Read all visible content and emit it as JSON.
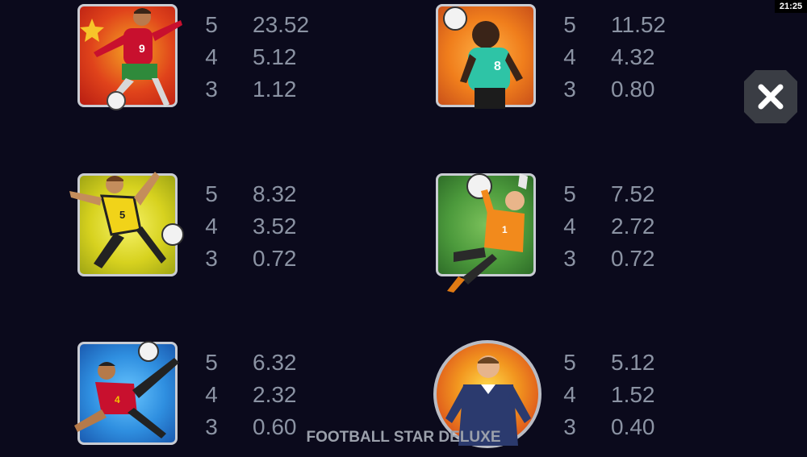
{
  "status_bar": {
    "time": "21:25"
  },
  "footer": {
    "game_title": "FOOTBALL STAR DELUXE"
  },
  "close_icon": "close-icon",
  "colors": {
    "background": "#0b0a1c",
    "text": "#8b93a3",
    "frame": "#c9ccd3"
  },
  "symbols": [
    {
      "name": "red-player-symbol",
      "payouts": [
        {
          "count": "5",
          "value": "23.52"
        },
        {
          "count": "4",
          "value": "5.12"
        },
        {
          "count": "3",
          "value": "1.12"
        }
      ]
    },
    {
      "name": "teal-player-symbol",
      "payouts": [
        {
          "count": "5",
          "value": "11.52"
        },
        {
          "count": "4",
          "value": "4.32"
        },
        {
          "count": "3",
          "value": "0.80"
        }
      ]
    },
    {
      "name": "yellow-player-symbol",
      "payouts": [
        {
          "count": "5",
          "value": "8.32"
        },
        {
          "count": "4",
          "value": "3.52"
        },
        {
          "count": "3",
          "value": "0.72"
        }
      ]
    },
    {
      "name": "goalkeeper-symbol",
      "payouts": [
        {
          "count": "5",
          "value": "7.52"
        },
        {
          "count": "4",
          "value": "2.72"
        },
        {
          "count": "3",
          "value": "0.72"
        }
      ]
    },
    {
      "name": "blue-player-symbol",
      "payouts": [
        {
          "count": "5",
          "value": "6.32"
        },
        {
          "count": "4",
          "value": "2.32"
        },
        {
          "count": "3",
          "value": "0.60"
        }
      ]
    },
    {
      "name": "referee-symbol",
      "payouts": [
        {
          "count": "5",
          "value": "5.12"
        },
        {
          "count": "4",
          "value": "1.52"
        },
        {
          "count": "3",
          "value": "0.40"
        }
      ]
    }
  ]
}
